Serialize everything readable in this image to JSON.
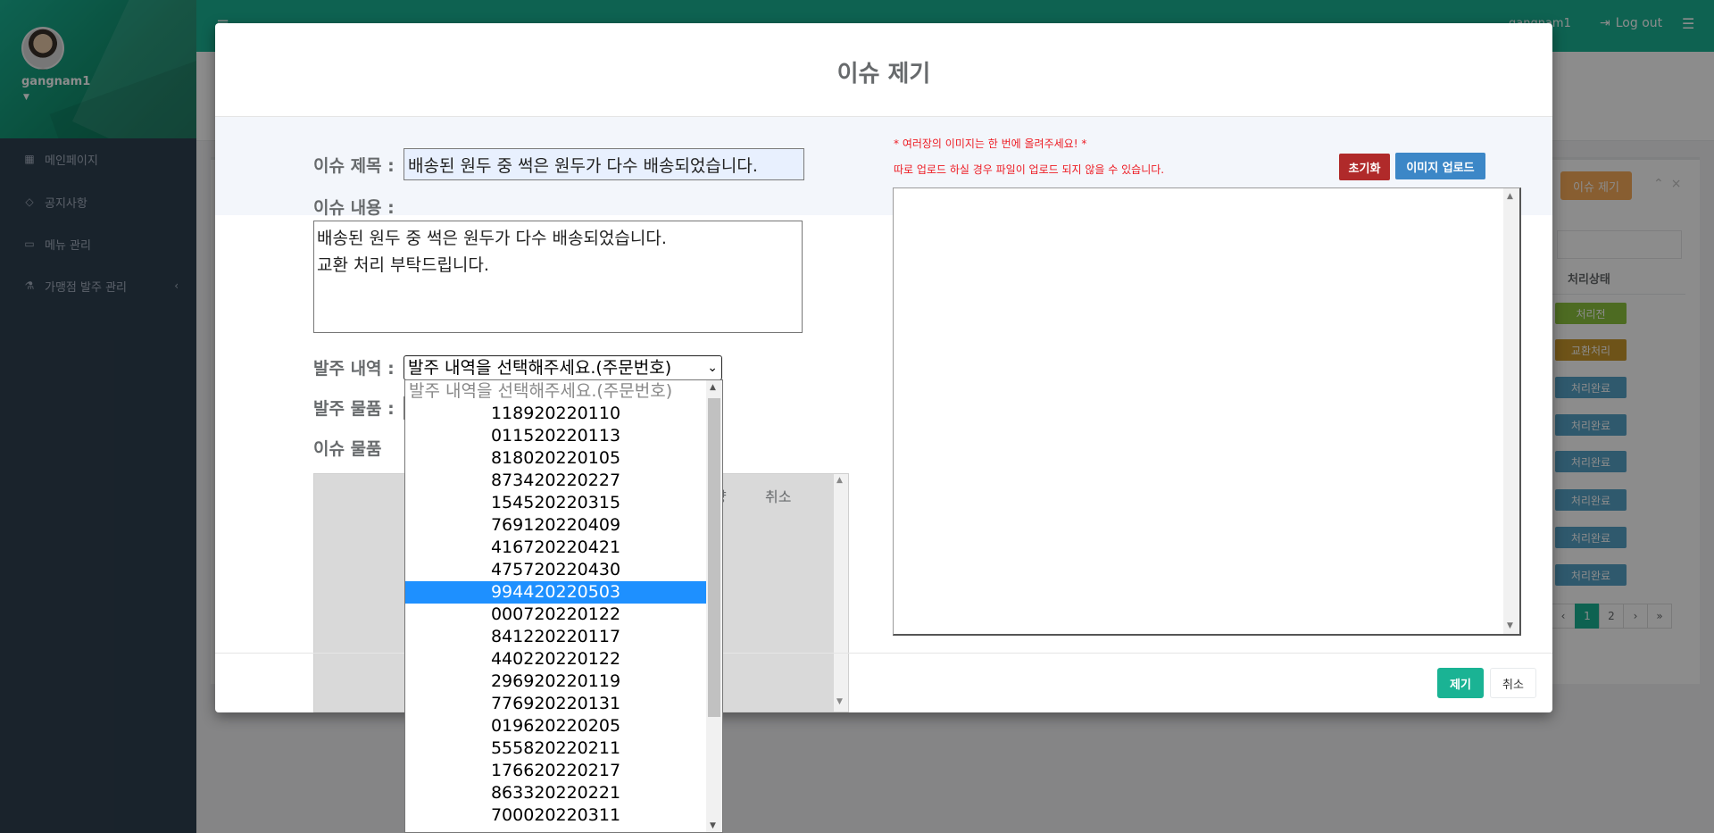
{
  "sidebar": {
    "profile_name": "gangnam1",
    "items": [
      {
        "label": "메인페이지",
        "icon": "th-large-icon"
      },
      {
        "label": "공지사항",
        "icon": "diamond-icon"
      },
      {
        "label": "메뉴 관리",
        "icon": "laptop-icon"
      },
      {
        "label": "가맹점 발주 관리",
        "icon": "flask-icon"
      }
    ]
  },
  "topbar": {
    "user": "gangnam1",
    "logout_label": "Log out"
  },
  "background": {
    "issue_button_label": "이슈 제기",
    "status_column_header": "처리상태",
    "statuses": [
      {
        "label": "처리전",
        "color": "#8cc43f"
      },
      {
        "label": "교환처리",
        "color": "#c9972c"
      },
      {
        "label": "처리완료",
        "color": "#57a3c6"
      },
      {
        "label": "처리완료",
        "color": "#57a3c6"
      },
      {
        "label": "처리완료",
        "color": "#57a3c6"
      },
      {
        "label": "처리완료",
        "color": "#57a3c6"
      },
      {
        "label": "처리완료",
        "color": "#57a3c6"
      },
      {
        "label": "처리완료",
        "color": "#57a3c6"
      }
    ],
    "pagination": [
      "‹",
      "1",
      "2",
      "›",
      "»"
    ],
    "current_page": "1"
  },
  "modal": {
    "title": "이슈 제기",
    "labels": {
      "issue_title": "이슈 제목 :",
      "issue_content": "이슈 내용 :",
      "order_history": "발주 내역 :",
      "order_goods": "발주 물품 :",
      "issue_goods": "이슈 물품"
    },
    "issue_title_value": "배송된 원두 중 썩은 원두가 다수 배송되었습니다.",
    "issue_content_value": "배송된 원두 중 썩은 원두가 다수 배송되었습니다.\n교환 처리 부탁드립니다.",
    "order_select_value": "발주 내역을 선택해주세요.(주문번호)",
    "issue_table_headers": {
      "qty": "량",
      "cancel": "취소"
    },
    "notice_line1": "* 여러장의 이미지는 한 번에 올려주세요! *",
    "notice_line2": "따로 업로드 하실 경우 파일이 업로드 되지 않을 수 있습니다.",
    "reset_label": "초기화",
    "upload_label": "이미지 업로드",
    "submit_label": "제기",
    "cancel_label": "취소"
  },
  "dropdown": {
    "placeholder": "발주 내역을 선택해주세요.(주문번호)",
    "options": [
      "118920220110",
      "011520220113",
      "818020220105",
      "873420220227",
      "154520220315",
      "769120220409",
      "416720220421",
      "475720220430",
      "994420220503",
      "000720220122",
      "841220220117",
      "440220220122",
      "296920220119",
      "776920220131",
      "019620220205",
      "555820220211",
      "176620220217",
      "863320220221",
      "700020220311"
    ],
    "selected": "994420220503"
  },
  "colors": {
    "brand": "#1ab394",
    "danger": "#b02a2a",
    "primary": "#3c87c7",
    "highlight": "#1e90ff"
  }
}
